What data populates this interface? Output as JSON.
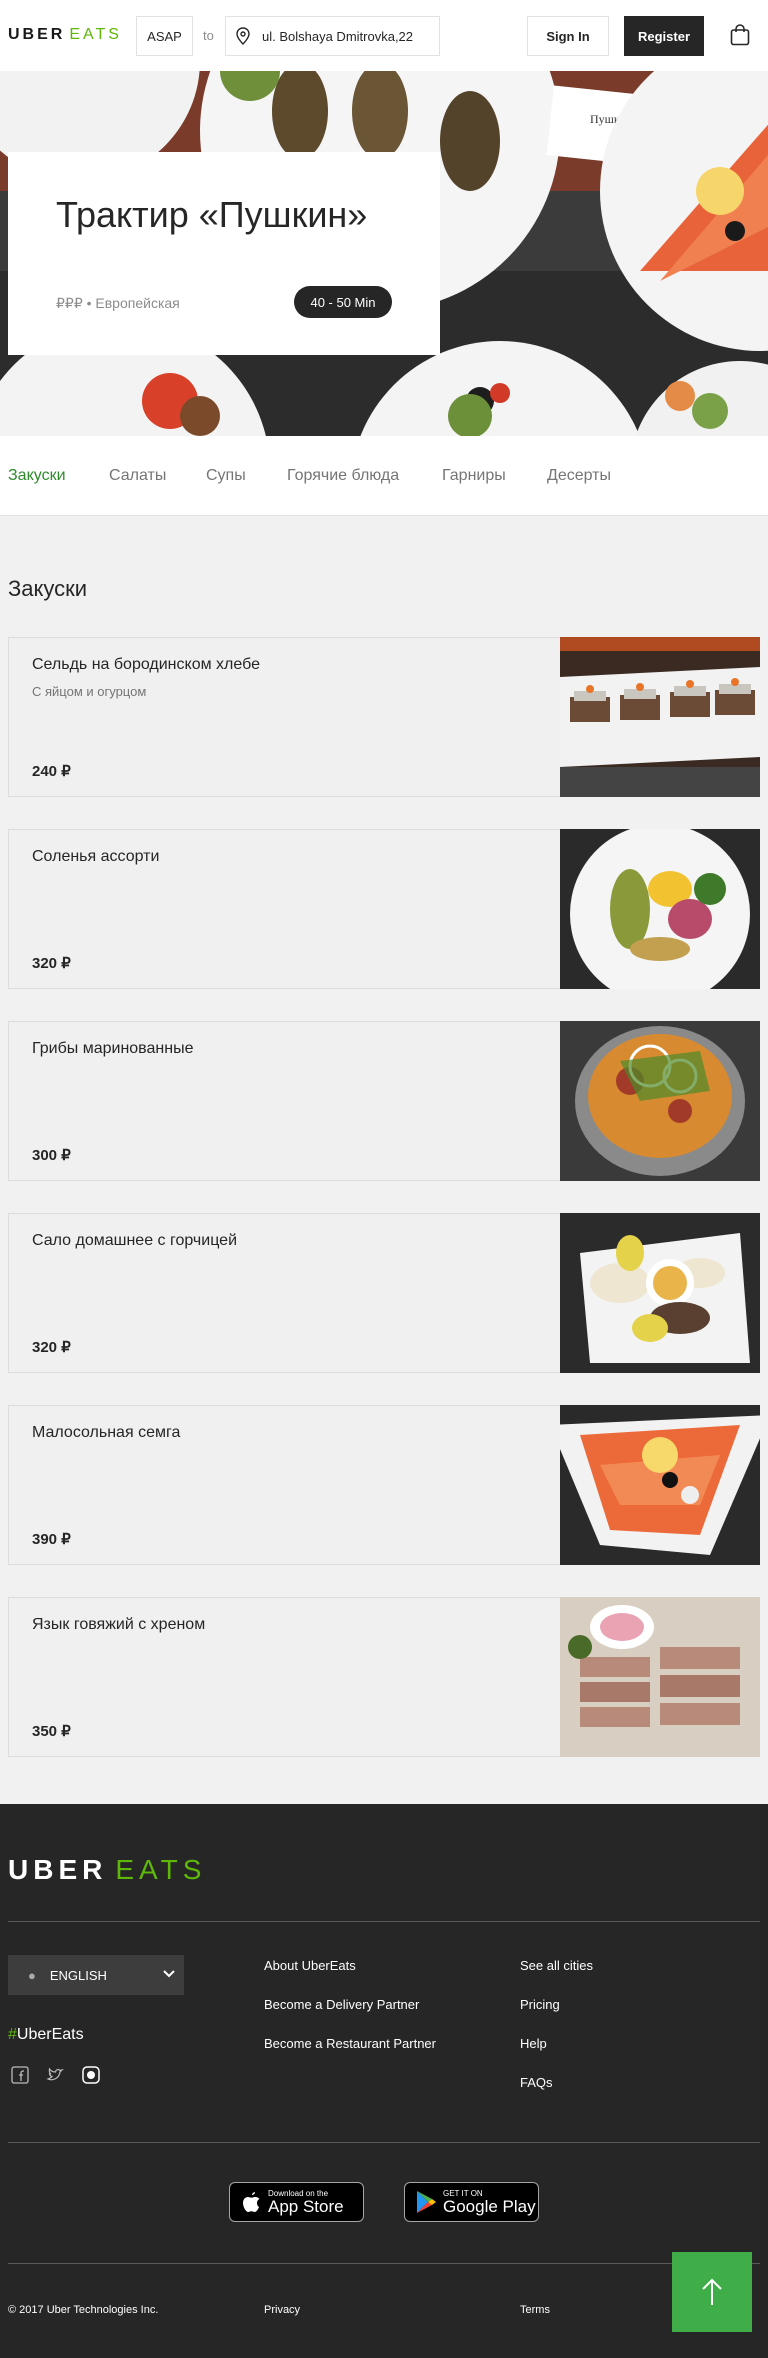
{
  "header": {
    "logo_uber": "UBER",
    "logo_eats": "EATS",
    "time_label": "ASAP",
    "to_label": "to",
    "address_value": "ul. Bolshaya Dmitrovka,22",
    "sign_in": "Sign In",
    "register": "Register",
    "cart_icon": "shopping-bag-icon"
  },
  "hero": {
    "restaurant_name": "Трактир «Пушкин»",
    "price_cuisine": "₽₽₽ • Европейская",
    "eta": "40 - 50 Min",
    "menu_card_text": "Пушкин"
  },
  "tabs": [
    {
      "label": "Закуски",
      "active": true
    },
    {
      "label": "Салаты",
      "active": false
    },
    {
      "label": "Супы",
      "active": false
    },
    {
      "label": "Горячие блюда",
      "active": false
    },
    {
      "label": "Гарниры",
      "active": false
    },
    {
      "label": "Десерты",
      "active": false
    }
  ],
  "menu": {
    "section_title": "Закуски",
    "items": [
      {
        "name": "Сельдь на бородинском хлебе",
        "description": "С яйцом и огурцом",
        "price": "240 ₽"
      },
      {
        "name": "Соленья ассорти",
        "description": "",
        "price": "320 ₽"
      },
      {
        "name": "Грибы маринованные",
        "description": "",
        "price": "300 ₽"
      },
      {
        "name": "Сало домашнее с горчицей",
        "description": "",
        "price": "320 ₽"
      },
      {
        "name": "Малосольная семга",
        "description": "",
        "price": "390 ₽"
      },
      {
        "name": "Язык говяжий с хреном",
        "description": "",
        "price": "350 ₽"
      }
    ]
  },
  "footer": {
    "logo_uber": "UBER",
    "logo_eats": "EATS",
    "language": "ENGLISH",
    "hashtag_symbol": "#",
    "hashtag_text": "UberEats",
    "col1": [
      "About UberEats",
      "Become a Delivery Partner",
      "Become a Restaurant Partner"
    ],
    "col2": [
      "See all cities",
      "Pricing",
      "Help",
      "FAQs"
    ],
    "app_store_small": "Download on the",
    "app_store_big": "App Store",
    "google_play_small": "GET IT ON",
    "google_play_big": "Google Play",
    "copyright": "© 2017 Uber Technologies Inc.",
    "privacy": "Privacy",
    "terms": "Terms"
  },
  "colors": {
    "brand_green": "#5fb709",
    "active_tab": "#2f8a2c",
    "dark": "#262626",
    "scroll_top": "#3fae49"
  }
}
